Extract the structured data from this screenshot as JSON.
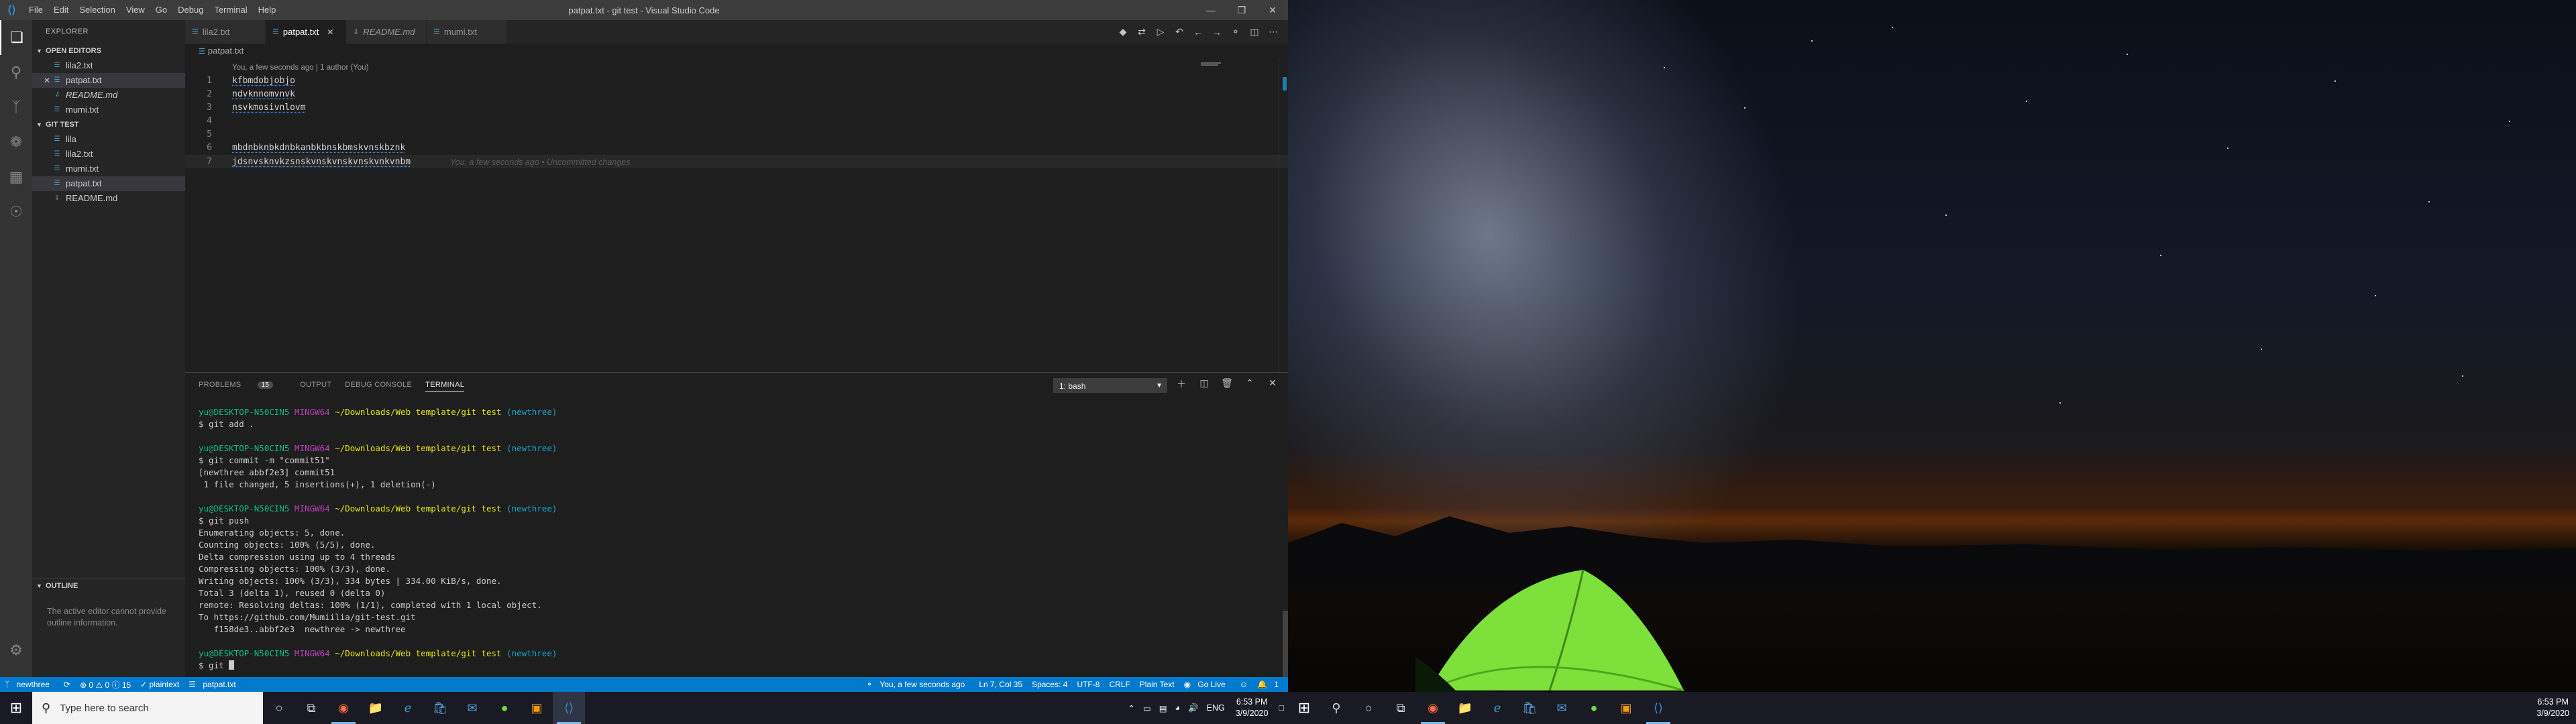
{
  "window": {
    "title": "patpat.txt - git test - Visual Studio Code",
    "menu": [
      "File",
      "Edit",
      "Selection",
      "View",
      "Go",
      "Debug",
      "Terminal",
      "Help"
    ]
  },
  "explorer": {
    "title": "EXPLORER",
    "open_editors_title": "OPEN EDITORS",
    "open_editors": [
      "lila2.txt",
      "patpat.txt",
      "README.md",
      "mumi.txt"
    ],
    "git_test_title": "GIT TEST",
    "git_test_files": [
      "lila",
      "lila2.txt",
      "mumi.txt",
      "patpat.txt",
      "README.md"
    ],
    "outline_title": "OUTLINE",
    "outline_message": "The active editor cannot provide outline information."
  },
  "tabs": [
    "lila2.txt",
    "patpat.txt",
    "README.md",
    "mumi.txt"
  ],
  "breadcrumb": "patpat.txt",
  "editor": {
    "codelens": "You, a few seconds ago | 1 author (You)",
    "lines": [
      {
        "n": "1",
        "text": "kfbmdobjobjo"
      },
      {
        "n": "2",
        "text": "ndvknnomvnvk"
      },
      {
        "n": "3",
        "text": "nsvkmosivnlovm"
      },
      {
        "n": "4",
        "text": ""
      },
      {
        "n": "5",
        "text": ""
      },
      {
        "n": "6",
        "text": "mbdnbknbkdnbkanbkbnskbmskvnskbznk"
      },
      {
        "n": "7",
        "text": "jdsnvsknvkzsnskvnskvnskvnskvnkvnbm"
      }
    ],
    "blame": "You, a few seconds ago • Uncommitted changes"
  },
  "panel": {
    "tabs": [
      "PROBLEMS",
      "OUTPUT",
      "DEBUG CONSOLE",
      "TERMINAL"
    ],
    "problems_count": "15",
    "terminal_select": "1: bash"
  },
  "terminal": {
    "prompt_user": "yu@DESKTOP-N50CIN5",
    "prompt_host": "MINGW64",
    "prompt_path": "~/Downloads/Web template/git test",
    "prompt_branch": "(newthree)",
    "cmd1": "$ git add .",
    "cmd2": "$ git commit -m \"commit51\"",
    "out2": [
      "[newthree abbf2e3] commit51",
      " 1 file changed, 5 insertions(+), 1 deletion(-)"
    ],
    "cmd3": "$ git push",
    "out3": [
      "Enumerating objects: 5, done.",
      "Counting objects: 100% (5/5), done.",
      "Delta compression using up to 4 threads",
      "Compressing objects: 100% (3/3), done.",
      "Writing objects: 100% (3/3), 334 bytes | 334.00 KiB/s, done.",
      "Total 3 (delta 1), reused 0 (delta 0)",
      "remote: Resolving deltas: 100% (1/1), completed with 1 local object.",
      "To https://github.com/Mumiilia/git-test.git",
      "   f158de3..abbf2e3  newthree -> newthree"
    ],
    "cmd4": "$ git "
  },
  "statusbar": {
    "branch": "newthree",
    "problems": "⊗ 0 ⚠ 0 ⓘ 15",
    "plaintext": "✓ plaintext",
    "file": "patpat.txt",
    "blame": "You, a few seconds ago",
    "position": "Ln 7, Col 35",
    "spaces": "Spaces: 4",
    "encoding": "UTF-8",
    "eol": "CRLF",
    "language": "Plain Text",
    "golive": "Go Live",
    "notifications": "1"
  },
  "taskbar": {
    "search_placeholder": "Type here to search",
    "lang": "ENG",
    "time": "6:53 PM",
    "date": "3/9/2020"
  },
  "taskbar2": {
    "time": "6:53 PM",
    "date": "3/9/2020"
  }
}
